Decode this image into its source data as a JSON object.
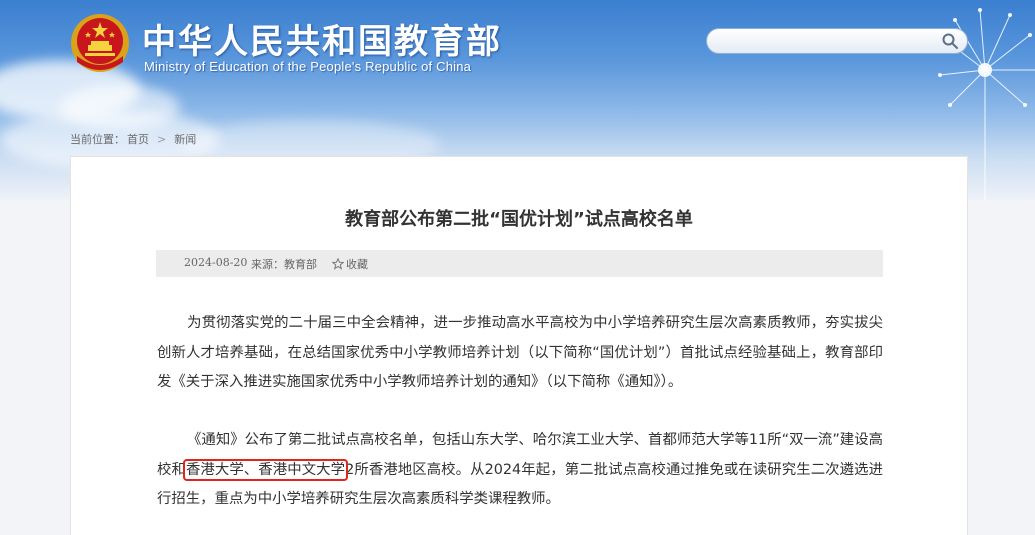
{
  "header": {
    "title": "中华人民共和国教育部",
    "subtitle": "Ministry of Education of the People's Republic of China",
    "search": {
      "value": "",
      "placeholder": ""
    }
  },
  "breadcrumb": {
    "prefix": "当前位置：",
    "items": [
      "首页",
      "新闻"
    ],
    "separator": ">"
  },
  "article": {
    "title": "教育部公布第二批“国优计划”试点高校名单",
    "meta": {
      "date": "2024-08-20",
      "source": "来源：教育部",
      "favorite_label": "收藏"
    },
    "paragraph1": "为贯彻落实党的二十届三中全会精神，进一步推动高水平高校为中小学培养研究生层次高素质教师，夯实拔尖创新人才培养基础，在总结国家优秀中小学教师培养计划（以下简称“国优计划”）首批试点经验基础上，教育部印发《关于深入推进实施国家优秀中小学教师培养计划的通知》（以下简称《通知》）。",
    "paragraph2_before": "《通知》公布了第二批试点高校名单，包括山东大学、哈尔滨工业大学、首都师范大学等11所“双一流”建设高校和",
    "paragraph2_highlight": "香港大学、香港中文大学",
    "paragraph2_after": "2所香港地区高校。从2024年起，第二批试点高校通过推免或在读研究生二次遴选进行招生，重点为中小学培养研究生层次高素质科学类课程教师。"
  },
  "colors": {
    "header_blue": "#3b7fd0",
    "highlight_red": "#e0261b",
    "text": "#333333"
  },
  "icons": [
    "national-emblem-icon",
    "search-icon",
    "star-icon",
    "dandelion-decoration"
  ]
}
